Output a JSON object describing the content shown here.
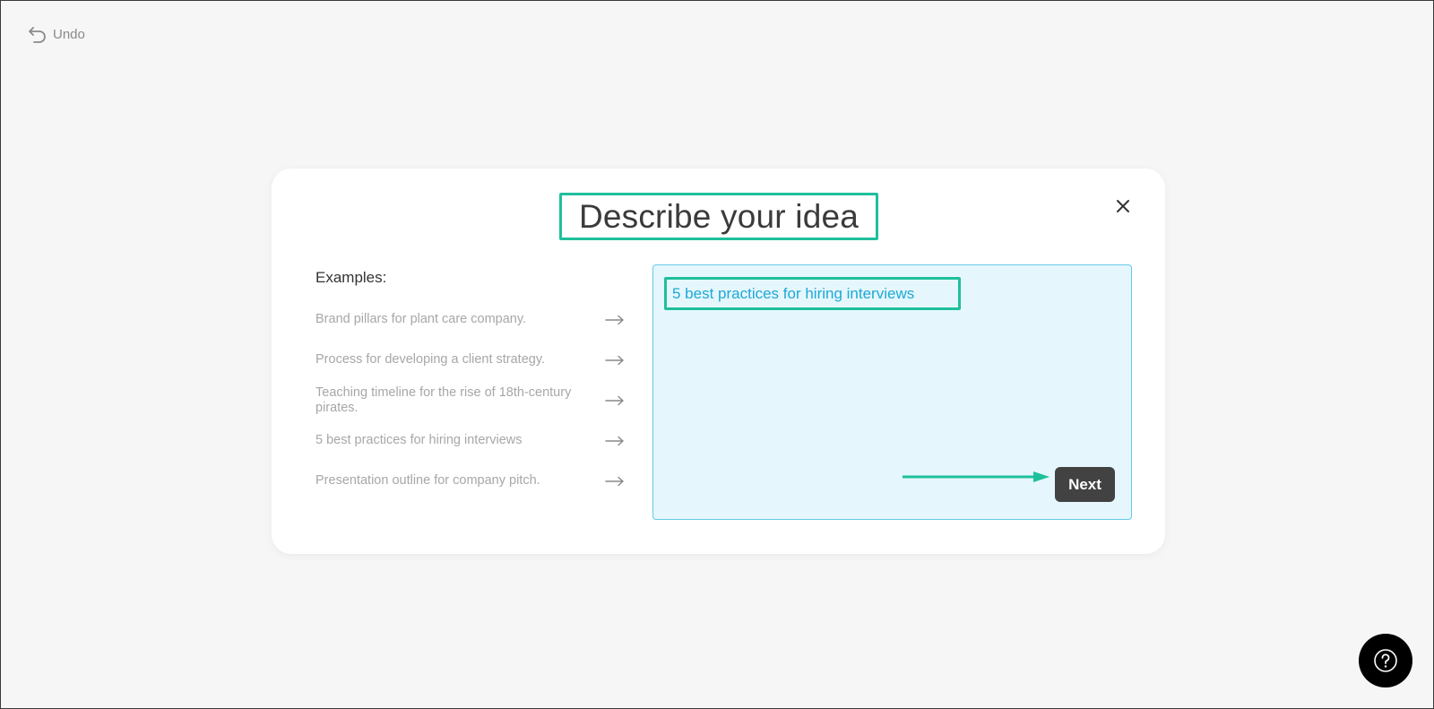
{
  "toolbar": {
    "undo_label": "Undo",
    "undo_icon": "undo-arrow-icon"
  },
  "modal": {
    "title": "Describe your idea",
    "close_icon": "close-icon",
    "examples_heading": "Examples:",
    "examples": [
      {
        "label": "Brand pillars for plant care company.",
        "icon": "arrow-right-icon"
      },
      {
        "label": "Process for developing a client strategy.",
        "icon": "arrow-right-icon"
      },
      {
        "label": "Teaching timeline for the rise of 18th-century pirates.",
        "icon": "arrow-right-icon"
      },
      {
        "label": "5 best practices for hiring interviews",
        "icon": "arrow-right-icon"
      },
      {
        "label": "Presentation outline for company pitch.",
        "icon": "arrow-right-icon"
      }
    ],
    "input_value": "5 best practices for hiring interviews",
    "next_label": "Next"
  },
  "help": {
    "icon": "help-question-icon"
  },
  "colors": {
    "highlight": "#1fbf9c",
    "input_bg": "#e5f7fd",
    "input_text": "#1ea8d6",
    "button_bg": "#424242"
  }
}
